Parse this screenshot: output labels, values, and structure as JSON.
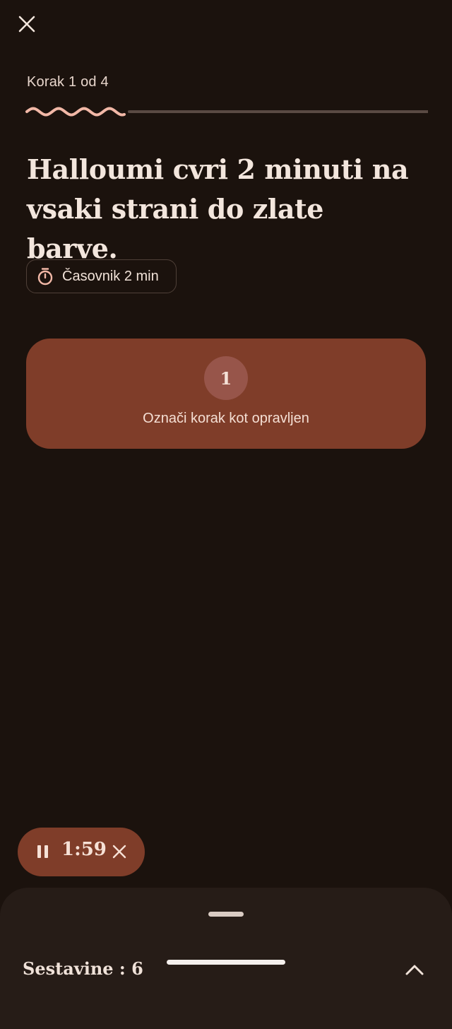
{
  "header": {
    "close_icon": "close-icon",
    "step_label": "Korak 1 od 4",
    "progress": {
      "current_step": 1,
      "total_steps": 4,
      "fraction": 0.25
    }
  },
  "step": {
    "instruction": "Halloumi cvri 2 minuti na vsaki strani do zlate barve.",
    "timer_chip": {
      "icon": "stopwatch-icon",
      "label": "Časovnik 2 min"
    },
    "done_card": {
      "number": "1",
      "label": "Označi korak kot opravljen"
    }
  },
  "running_timer": {
    "pause_icon": "pause-icon",
    "time": "1:59",
    "close_icon": "close-icon"
  },
  "sheet": {
    "title": "Sestavine : 6",
    "chevron_icon": "chevron-up-icon"
  },
  "colors": {
    "background": "#1b120d",
    "accent": "#7f3d29",
    "progress_done": "#f2b8a7",
    "progress_track": "#5a4a43",
    "sheet": "#261c17"
  }
}
